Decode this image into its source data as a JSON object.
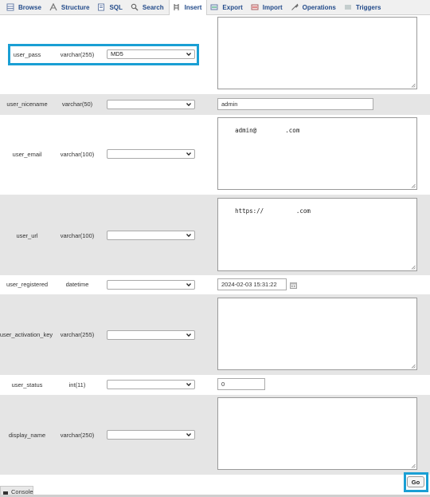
{
  "tabs": [
    {
      "label": "Browse",
      "icon": "browse-icon"
    },
    {
      "label": "Structure",
      "icon": "structure-icon"
    },
    {
      "label": "SQL",
      "icon": "sql-icon"
    },
    {
      "label": "Search",
      "icon": "search-icon"
    },
    {
      "label": "Insert",
      "icon": "insert-icon",
      "active": true
    },
    {
      "label": "Export",
      "icon": "export-icon"
    },
    {
      "label": "Import",
      "icon": "import-icon"
    },
    {
      "label": "Operations",
      "icon": "operations-icon"
    },
    {
      "label": "Triggers",
      "icon": "triggers-icon"
    }
  ],
  "fields": {
    "user_pass": {
      "name": "user_pass",
      "type": "varchar(255)",
      "function": "MD5",
      "value": ""
    },
    "user_nicename": {
      "name": "user_nicename",
      "type": "varchar(50)",
      "function": "",
      "value": "admin"
    },
    "user_email": {
      "name": "user_email",
      "type": "varchar(100)",
      "function": "",
      "value": "admin@        .com"
    },
    "user_url": {
      "name": "user_url",
      "type": "varchar(100)",
      "function": "",
      "value": "https://         .com"
    },
    "user_registered": {
      "name": "user_registered",
      "type": "datetime",
      "function": "",
      "value": "2024-02-03 15:31:22"
    },
    "user_activation_key": {
      "name": "user_activation_key",
      "type": "varchar(255)",
      "function": "",
      "value": ""
    },
    "user_status": {
      "name": "user_status",
      "type": "int(11)",
      "function": "",
      "value": "0"
    },
    "display_name": {
      "name": "display_name",
      "type": "varchar(250)",
      "function": "",
      "value": ""
    }
  },
  "footer": {
    "console_label": "Console",
    "go_label": "Go"
  },
  "colors": {
    "highlight": "#1a9fd4",
    "tab_text": "#234b8a",
    "row_alt": "#e5e5e5"
  }
}
